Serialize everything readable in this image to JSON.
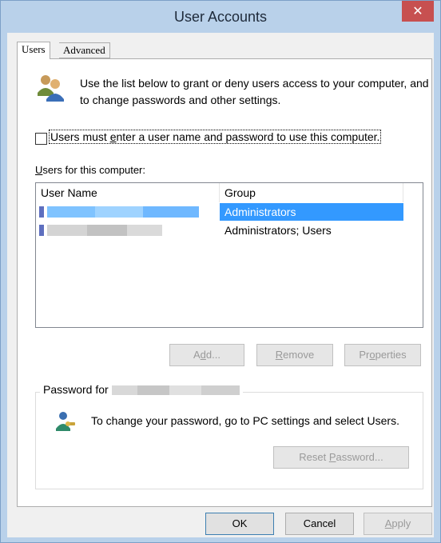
{
  "window": {
    "title": "User Accounts",
    "close_glyph": "✕"
  },
  "tabs": [
    {
      "label": "Users",
      "selected": true
    },
    {
      "label": "Advanced",
      "selected": false
    }
  ],
  "users_tab": {
    "intro_text": "Use the list below to grant or deny users access to your computer, and to change passwords and other settings.",
    "must_login_checkbox": {
      "label_before": "Users must ",
      "label_accel": "e",
      "label_after": "nter a user name and password to use this computer.",
      "checked": false
    },
    "list_label_accel": "U",
    "list_label_rest": "sers for this computer:",
    "columns": [
      "User Name",
      "Group"
    ],
    "rows": [
      {
        "user_name": "",
        "group": "Administrators",
        "selected": true
      },
      {
        "user_name": "",
        "group": "Administrators; Users",
        "selected": false
      }
    ],
    "buttons": {
      "add": {
        "before": "A",
        "accel": "d",
        "after": "d...",
        "enabled": false
      },
      "remove": {
        "before": "",
        "accel": "R",
        "after": "emove",
        "enabled": false
      },
      "properties": {
        "before": "Pr",
        "accel": "o",
        "after": "perties",
        "enabled": false
      }
    },
    "password_group": {
      "label": "Password for",
      "text": "To change your password, go to PC settings and select Users.",
      "reset_button": {
        "before": "Reset ",
        "accel": "P",
        "after": "assword...",
        "enabled": false
      }
    }
  },
  "dialog_buttons": {
    "ok": "OK",
    "cancel": "Cancel",
    "apply": {
      "accel": "A",
      "after": "pply",
      "enabled": false
    }
  },
  "colors": {
    "selection": "#3399ff",
    "close_button": "#c75050",
    "titlebar": "#b9d1ea",
    "disabled_text": "#9a9a9a"
  },
  "icons": {
    "users": "users-icon",
    "password": "user-key-icon",
    "close": "close-icon"
  }
}
